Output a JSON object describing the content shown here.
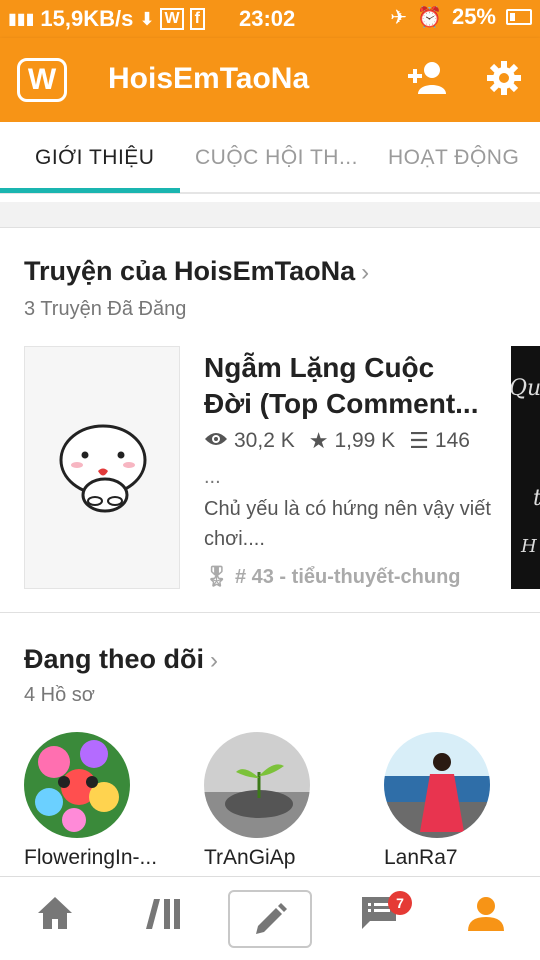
{
  "status_bar": {
    "network": "15,9KB/s",
    "time": "23:02",
    "battery": "25%"
  },
  "app_bar": {
    "logo_letter": "W",
    "title": "HoisEmTaoNa",
    "icons": [
      "add-person-icon",
      "settings-gear-icon"
    ]
  },
  "tabs": [
    {
      "label": "GIỚI THIỆU",
      "active": true
    },
    {
      "label": "CUỘC HỘI TH...",
      "active": false
    },
    {
      "label": "HOẠT ĐỘNG",
      "active": false
    }
  ],
  "stories_section": {
    "title": "Truyện của HoisEmTaoNa",
    "subtitle": "3 Truyện Đã Đăng",
    "story": {
      "title": "Ngẫm Lặng Cuộc Đời (Top Comment...",
      "reads": "30,2 K",
      "votes": "1,99 K",
      "parts": "146",
      "ellipsis": "...",
      "description": "Chủ yếu là có hứng nên vậy viết chơi....",
      "rank": "# 43 - tiểu-thuyết-chung"
    },
    "next_cover_text": [
      "Qu",
      "t",
      "H"
    ]
  },
  "following_section": {
    "title": "Đang theo dõi",
    "subtitle": "4 Hồ sơ",
    "profiles": [
      {
        "name": "FloweringIn-..."
      },
      {
        "name": "TrAnGiAp"
      },
      {
        "name": "LanRa7"
      }
    ]
  },
  "bottom_nav": {
    "items": [
      "home-icon",
      "library-icon",
      "write-icon",
      "messages-icon",
      "profile-icon"
    ],
    "messages_badge": "7"
  },
  "colors": {
    "accent": "#f79416",
    "tab_indicator": "#1ab5b0",
    "badge": "#e53a35"
  }
}
